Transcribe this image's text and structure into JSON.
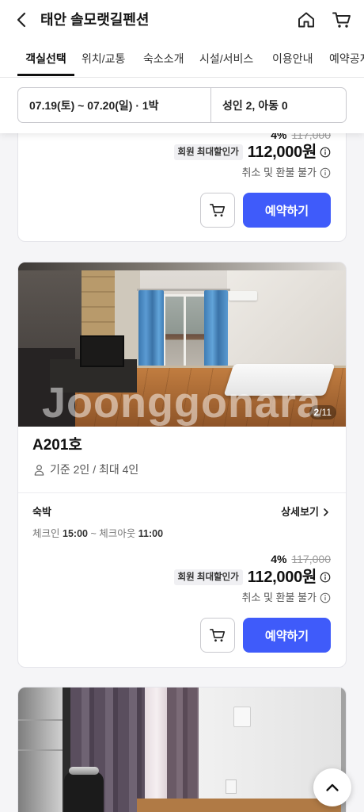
{
  "header": {
    "title": "태안 솔모랫길펜션",
    "icons": {
      "back": "chevron-left-icon",
      "home": "home-icon",
      "cart": "cart-icon"
    }
  },
  "tabs": [
    {
      "label": "객실선택",
      "active": true
    },
    {
      "label": "위치/교통",
      "active": false
    },
    {
      "label": "숙소소개",
      "active": false
    },
    {
      "label": "시설/서비스",
      "active": false
    },
    {
      "label": "이용안내",
      "active": false
    },
    {
      "label": "예약공지",
      "active": false
    }
  ],
  "search": {
    "dates": "07.19(토) ~ 07.20(일) · 1박",
    "guests": "성인 2, 아동 0"
  },
  "rooms": [
    {
      "plan": {
        "discount": "4%",
        "original_price": "117,000",
        "member_badge": "회원 최대할인가",
        "price": "112,000원",
        "policy": "취소 및 환불 불가",
        "reserve_label": "예약하기"
      }
    },
    {
      "photo": {
        "current": "2",
        "separator": "/",
        "total": "11",
        "watermark": "Joonggonara"
      },
      "name": "A201호",
      "capacity": "기준 2인 / 최대 4인",
      "plan": {
        "type": "숙박",
        "detail_label": "상세보기",
        "checkin_label": "체크인",
        "checkin_time": "15:00",
        "separator": "~",
        "checkout_label": "체크아웃",
        "checkout_time": "11:00",
        "discount": "4%",
        "original_price": "117,000",
        "member_badge": "회원 최대할인가",
        "price": "112,000원",
        "policy": "취소 및 환불 불가",
        "reserve_label": "예약하기"
      }
    }
  ],
  "icons": {
    "info": "info-circle-icon",
    "person": "person-icon",
    "detail": "chevron-right-icon",
    "scroll_top": "chevron-up-icon"
  },
  "colors": {
    "accent": "#3f5bfa",
    "text": "#1a1a1a",
    "muted": "#555555"
  }
}
